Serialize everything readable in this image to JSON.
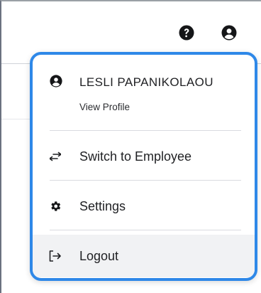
{
  "header": {
    "help_icon": "question-circle-icon",
    "profile_icon": "user-circle-icon"
  },
  "menu": {
    "user": {
      "name": "LESLI PAPANIKOLAOU",
      "subtitle": "View Profile",
      "icon": "user-circle-icon"
    },
    "items": [
      {
        "label": "Switch to Employee",
        "icon": "switch-arrows-icon"
      },
      {
        "label": "Settings",
        "icon": "gear-icon"
      },
      {
        "label": "Logout",
        "icon": "logout-icon"
      }
    ],
    "accent_color": "#2e88e8",
    "hover_background": "#f1f2f4"
  }
}
